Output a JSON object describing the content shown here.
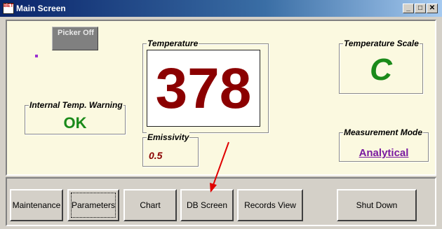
{
  "window": {
    "title": "Main Screen",
    "icon_text": "BET",
    "controls": {
      "minimize": "_",
      "maximize": "□",
      "close": "✕"
    }
  },
  "picker": {
    "label": "Picker Off"
  },
  "temperature": {
    "label": "Temperature",
    "value": "378"
  },
  "scale": {
    "label": "Temperature Scale",
    "value": "C"
  },
  "internal_warning": {
    "label": "Internal Temp. Warning",
    "value": "OK"
  },
  "emissivity": {
    "label": "Emissivity",
    "value": "0.5"
  },
  "measurement_mode": {
    "label": "Measurement Mode",
    "value": "Analytical"
  },
  "buttons": {
    "maintenance": "Maintenance",
    "parameters": "Parameters",
    "chart": "Chart",
    "db_screen": "DB Screen",
    "records_view": "Records View",
    "shut_down": "Shut Down"
  },
  "colors": {
    "panel_bg": "#fbf9e0",
    "temperature_value": "#8b0000",
    "ok_value": "#1a8a1a",
    "scale_value": "#1a8a1a",
    "measurement_mode_value": "#7a1aa0",
    "annotation_arrow": "#e00000"
  }
}
